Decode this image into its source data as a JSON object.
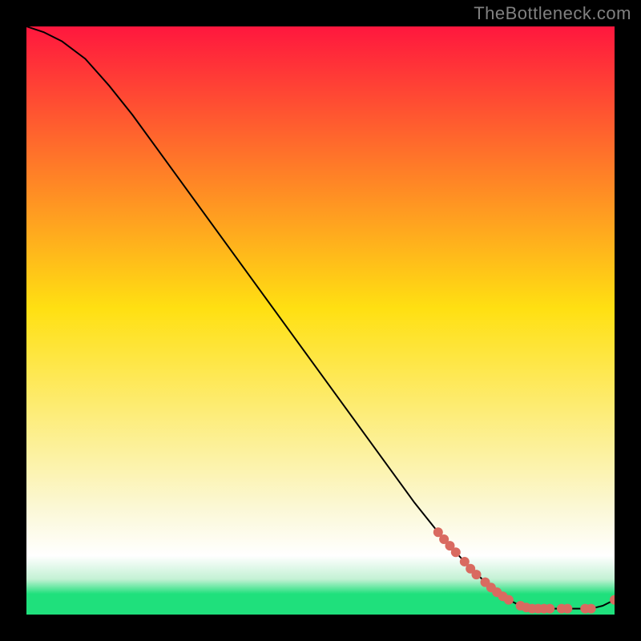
{
  "watermark": "TheBottleneck.com",
  "colors": {
    "gradient_top": "#ff173e",
    "gradient_yellow": "#ffe012",
    "gradient_pale": "#fbf8d6",
    "gradient_white": "#ffffff",
    "gradient_mint": "#c3f1d4",
    "gradient_green": "#1fe07c",
    "curve": "#000000",
    "marker": "#d96a60"
  },
  "chart_data": {
    "type": "line",
    "title": "",
    "xlabel": "",
    "ylabel": "",
    "xlim": [
      0,
      100
    ],
    "ylim": [
      0,
      100
    ],
    "grid": false,
    "series": [
      {
        "name": "bottleneck-curve",
        "x": [
          0,
          3,
          6,
          10,
          14,
          18,
          22,
          26,
          30,
          34,
          38,
          42,
          46,
          50,
          54,
          58,
          62,
          66,
          70,
          74,
          78,
          82,
          84,
          86,
          88,
          90,
          92,
          94,
          96,
          98,
          100
        ],
        "y": [
          100,
          99,
          97.5,
          94.5,
          90,
          85,
          79.5,
          74,
          68.5,
          63,
          57.5,
          52,
          46.5,
          41,
          35.5,
          30,
          24.5,
          19,
          14,
          9.5,
          5.5,
          2.5,
          1.5,
          1,
          1,
          1,
          1,
          1,
          1,
          1.5,
          2.5
        ]
      }
    ],
    "markers": [
      {
        "x": 70,
        "y": 14
      },
      {
        "x": 71,
        "y": 12.8
      },
      {
        "x": 72,
        "y": 11.7
      },
      {
        "x": 73,
        "y": 10.6
      },
      {
        "x": 74.5,
        "y": 9
      },
      {
        "x": 75.5,
        "y": 7.8
      },
      {
        "x": 76.5,
        "y": 6.8
      },
      {
        "x": 78,
        "y": 5.5
      },
      {
        "x": 79,
        "y": 4.6
      },
      {
        "x": 80,
        "y": 3.8
      },
      {
        "x": 81,
        "y": 3.1
      },
      {
        "x": 82,
        "y": 2.5
      },
      {
        "x": 84,
        "y": 1.5
      },
      {
        "x": 85,
        "y": 1.2
      },
      {
        "x": 86,
        "y": 1
      },
      {
        "x": 87,
        "y": 1
      },
      {
        "x": 88,
        "y": 1
      },
      {
        "x": 89,
        "y": 1
      },
      {
        "x": 91,
        "y": 1
      },
      {
        "x": 92,
        "y": 1
      },
      {
        "x": 95,
        "y": 1
      },
      {
        "x": 96,
        "y": 1
      },
      {
        "x": 100,
        "y": 2.5
      }
    ],
    "gradient_stops": [
      {
        "offset": 0.0,
        "color_key": "gradient_top"
      },
      {
        "offset": 0.48,
        "color_key": "gradient_yellow"
      },
      {
        "offset": 0.82,
        "color_key": "gradient_pale"
      },
      {
        "offset": 0.9,
        "color_key": "gradient_white"
      },
      {
        "offset": 0.94,
        "color_key": "gradient_mint"
      },
      {
        "offset": 0.965,
        "color_key": "gradient_green"
      },
      {
        "offset": 1.0,
        "color_key": "gradient_green"
      }
    ]
  }
}
